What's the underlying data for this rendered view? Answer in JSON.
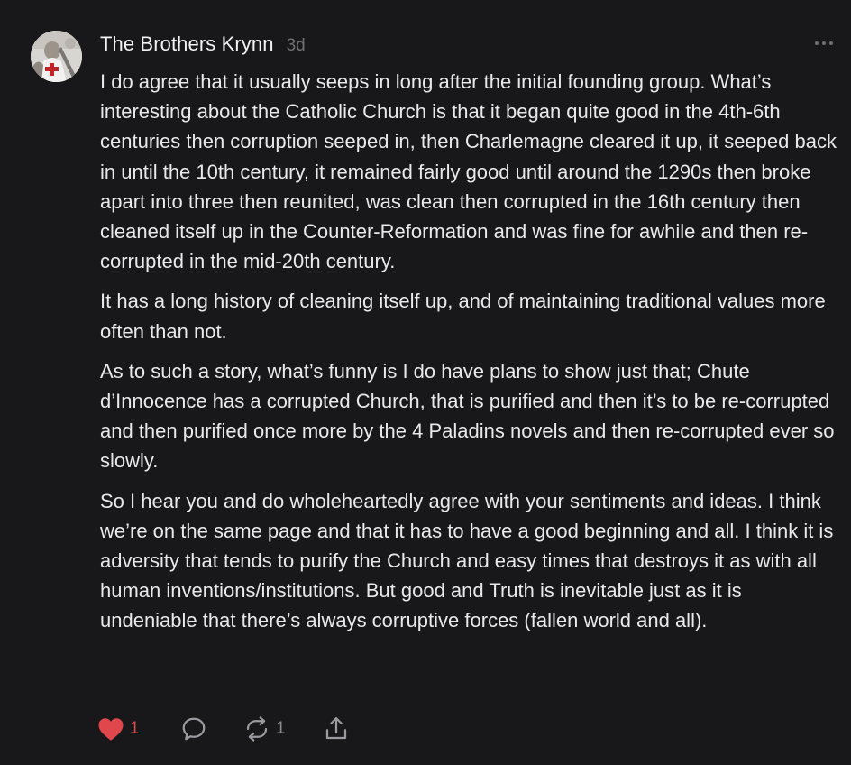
{
  "comment": {
    "author": "The Brothers Krynn",
    "time": "3d",
    "paragraphs": [
      "I do agree that it usually seeps in long after the initial founding group. What’s interesting about the Catholic Church is that it began quite good in the 4th-6th centuries then corruption seeped in, then Charlemagne cleared it up, it seeped back in until the 10th century, it remained fairly good until around the 1290s then broke apart into three then reunited, was clean then corrupted in the 16th century then cleaned itself up in the Counter-Reformation and was fine for awhile and then re-corrupted in the mid-20th century.",
      "It has a long history of cleaning itself up, and of maintaining traditional values more often than not.",
      "As to such a story, what’s funny is I do have plans to show just that; Chute d’Innocence has a corrupted Church, that is purified and then it’s to be re-corrupted and then purified once more by the 4 Paladins novels and then re-corrupted ever so slowly.",
      "So I hear you and do wholeheartedly agree with your sentiments and ideas. I think we’re on the same page and that it has to have a good beginning and all. I think it is adversity that tends to purify the Church and easy times that destroys it as with all human inventions/institutions. But good and Truth is inevitable just as it is undeniable that there’s always corruptive forces (fallen world and all)."
    ]
  },
  "actions": {
    "likes": "1",
    "restacks": "1"
  },
  "icons": {
    "more": "more-horizontal-icon",
    "like": "heart-icon",
    "comment": "comment-bubble-icon",
    "restack": "restack-arrows-icon",
    "share": "share-upload-icon"
  },
  "colors": {
    "background": "#18181a",
    "text": "#e9e9ea",
    "muted": "#6f6f74",
    "like_red": "#e0474c"
  }
}
